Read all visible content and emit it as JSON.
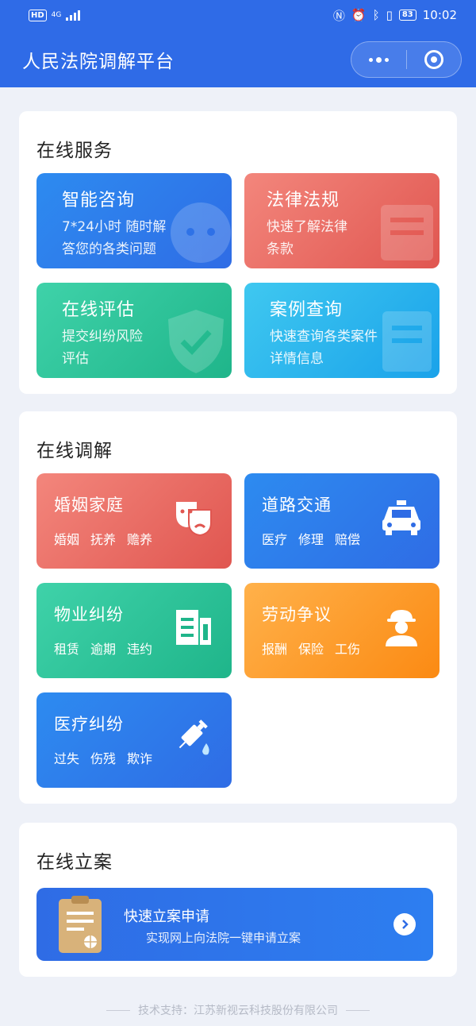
{
  "status_bar": {
    "hd": "HD",
    "network": "4G",
    "battery": "83",
    "time": "10:02"
  },
  "nav": {
    "title": "人民法院调解平台"
  },
  "online_services": {
    "title": "在线服务",
    "tiles": [
      {
        "title": "智能咨询",
        "desc_line1": "7*24小时 随时解",
        "desc_line2": "答您的各类问题",
        "color": "#2f6ce5"
      },
      {
        "title": "法律法规",
        "desc_line1": "快速了解法律",
        "desc_line2": "条款",
        "color": "#e05650"
      },
      {
        "title": "在线评估",
        "desc_line1": "提交纠纷风险",
        "desc_line2": "评估",
        "color": "#1fb58a"
      },
      {
        "title": "案例查询",
        "desc_line1": "快速查询各类案件",
        "desc_line2": "详情信息",
        "color": "#1aa2ea"
      }
    ]
  },
  "online_mediation": {
    "title": "在线调解",
    "tiles": [
      {
        "title": "婚姻家庭",
        "tags": [
          "婚姻",
          "抚养",
          "赡养"
        ],
        "icon": "masks-icon"
      },
      {
        "title": "道路交通",
        "tags": [
          "医疗",
          "修理",
          "赔偿"
        ],
        "icon": "taxi-icon"
      },
      {
        "title": "物业纠纷",
        "tags": [
          "租赁",
          "逾期",
          "违约"
        ],
        "icon": "building-icon"
      },
      {
        "title": "劳动争议",
        "tags": [
          "报酬",
          "保险",
          "工伤"
        ],
        "icon": "worker-icon"
      },
      {
        "title": "医疗纠纷",
        "tags": [
          "过失",
          "伤残",
          "欺诈"
        ],
        "icon": "syringe-icon"
      }
    ]
  },
  "online_filing": {
    "title": "在线立案",
    "banner_title": "快速立案申请",
    "banner_subtitle": "实现网上向法院一键申请立案"
  },
  "footer": {
    "text": "技术支持：江苏新视云科技股份有限公司"
  }
}
